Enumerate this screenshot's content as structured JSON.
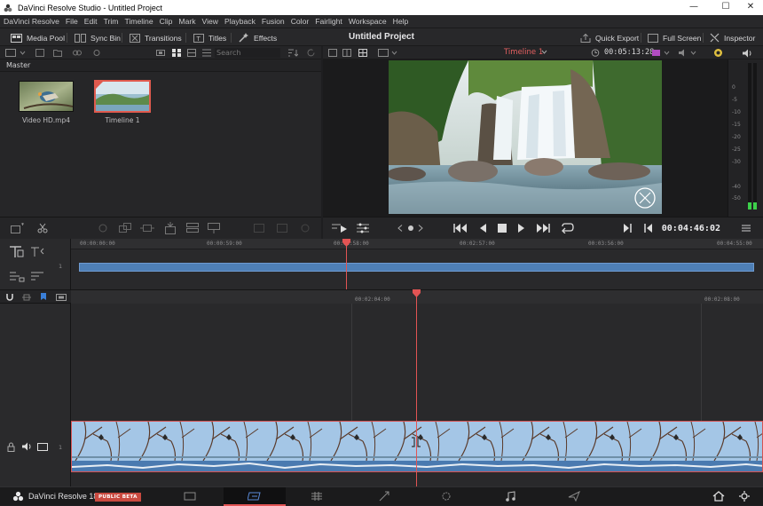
{
  "window": {
    "title": "DaVinci Resolve Studio - Untitled Project"
  },
  "menu": [
    "DaVinci Resolve",
    "File",
    "Edit",
    "Trim",
    "Timeline",
    "Clip",
    "Mark",
    "View",
    "Playback",
    "Fusion",
    "Color",
    "Fairlight",
    "Workspace",
    "Help"
  ],
  "toolbar": {
    "media_pool": "Media Pool",
    "sync_bin": "Sync Bin",
    "transitions": "Transitions",
    "titles": "Titles",
    "effects": "Effects",
    "project_title": "Untitled Project",
    "quick_export": "Quick Export",
    "full_screen": "Full Screen",
    "inspector": "Inspector"
  },
  "media_pool": {
    "search_placeholder": "Search",
    "bin_name": "Master",
    "clips": [
      {
        "label": "Video HD.mp4"
      },
      {
        "label": "Timeline 1"
      }
    ]
  },
  "viewer": {
    "timeline_name": "Timeline 1",
    "duration_tc": "00:05:13:28",
    "current_tc": "00:04:46:02"
  },
  "meter": {
    "ticks": [
      "0",
      "-5",
      "-10",
      "-15",
      "-20",
      "-25",
      "-30",
      "-40",
      "-50"
    ]
  },
  "upper_ruler": [
    "00:00:00:00",
    "00:00:59:00",
    "00:01:58:00",
    "00:02:57:00",
    "00:03:56:00",
    "00:04:55:00"
  ],
  "lower_ruler": [
    "00:02:04:00",
    "00:02:08:00"
  ],
  "tracks": {
    "upper_track_number": "1",
    "audio_track_number": "1"
  },
  "bottom": {
    "app_name": "DaVinci Resolve 18",
    "badge": "PUBLIC BETA"
  },
  "colors": {
    "accent_red": "#e25454",
    "clip_blue": "#4e7fb6",
    "badge": "#c94a40",
    "timecode_red": "#e36060"
  }
}
